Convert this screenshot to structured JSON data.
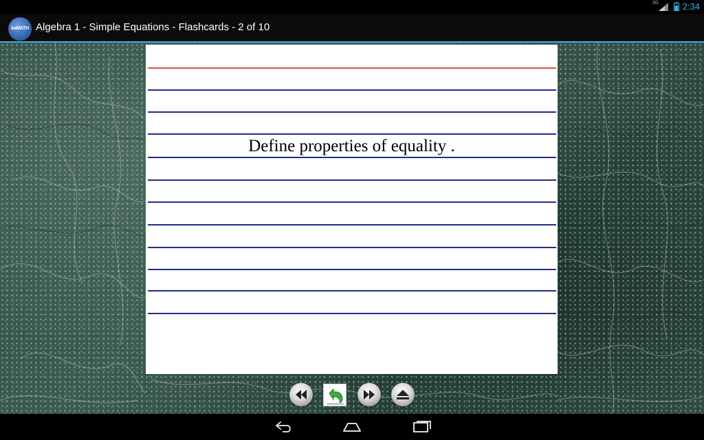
{
  "status_bar": {
    "time": "2:34",
    "network": "3G",
    "icons": [
      "signal-icon",
      "battery-icon"
    ]
  },
  "action_bar": {
    "app_icon_text": "kaMATH",
    "title": "Algebra 1 - Simple Equations - Flashcards - 2 of 10"
  },
  "flashcard": {
    "text": "Define properties of equality ."
  },
  "controls": {
    "icons": [
      "rewind-icon",
      "flip-card-icon",
      "fast-forward-icon",
      "eject-icon"
    ]
  },
  "nav_bar": {
    "icons": [
      "back-icon",
      "home-icon",
      "recent-apps-icon"
    ]
  },
  "colors": {
    "accent": "#33b5e5",
    "red_rule": "#e05050",
    "blue_rule": "#1f2c8a"
  }
}
